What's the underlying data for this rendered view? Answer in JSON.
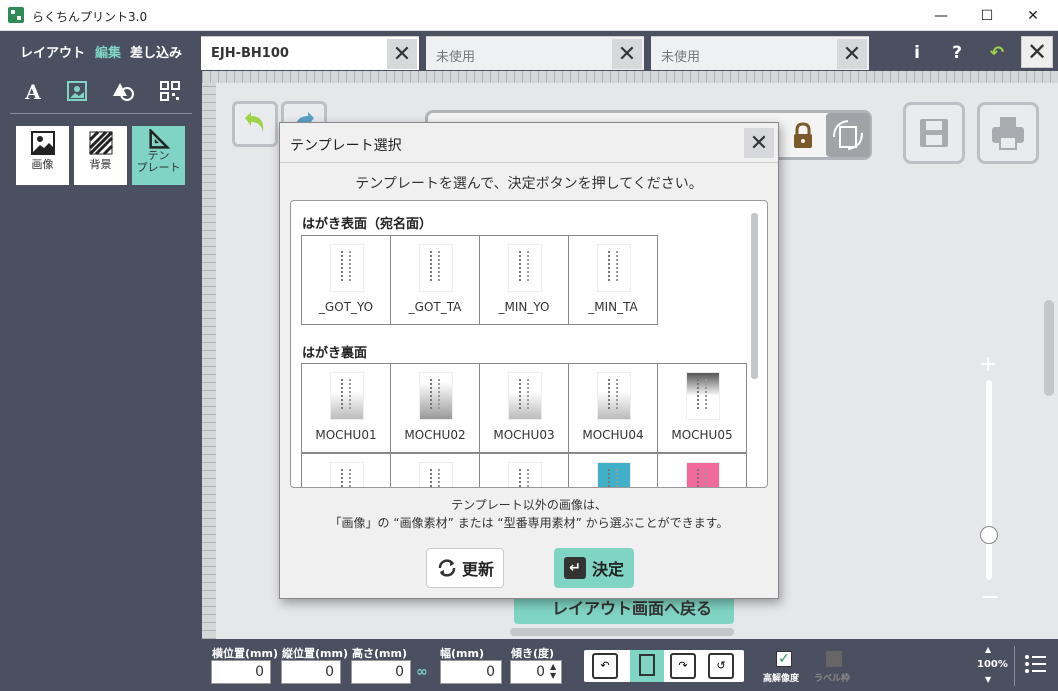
{
  "app": {
    "title": "らくちんプリント3.0"
  },
  "menu": {
    "layout": "レイアウト",
    "edit": "編集",
    "merge": "差し込み"
  },
  "tabs": [
    {
      "label": "EJH-BH100"
    },
    {
      "label": "未使用"
    },
    {
      "label": "未使用"
    }
  ],
  "header_icons": {
    "info": "i",
    "help": "?"
  },
  "tools": {
    "image_label": "画像",
    "background_label": "背景",
    "template_label": "テン\nプレート"
  },
  "canvas": {
    "back_to_layout": "レイアウト画面へ戻る"
  },
  "bottom": {
    "x_label": "横位置(mm)",
    "x_value": "0",
    "y_label": "縦位置(mm)",
    "y_value": "0",
    "h_label": "高さ(mm)",
    "h_value": "0",
    "w_label": "幅(mm)",
    "w_value": "0",
    "angle_label": "傾き(度)",
    "angle_value": "0",
    "hires_label": "高解像度",
    "label_frame_label": "ラベル枠",
    "zoom": "100%"
  },
  "dialog": {
    "title": "テンプレート選択",
    "instruction": "テンプレートを選んで、決定ボタンを押してください。",
    "section1": {
      "heading": "はがき表面（宛名面）",
      "items": [
        "_GOT_YO",
        "_GOT_TA",
        "_MIN_YO",
        "_MIN_TA"
      ]
    },
    "section2": {
      "heading": "はがき裏面",
      "items": [
        "MOCHU01",
        "MOCHU02",
        "MOCHU03",
        "MOCHU04",
        "MOCHU05"
      ]
    },
    "note1": "テンプレート以外の画像は、",
    "note2": "「画像」の “画像素材” または “型番専用素材” から選ぶことができます。",
    "refresh_label": "更新",
    "ok_label": "決定"
  },
  "colors": {
    "dark_panel": "#4a5060",
    "accent": "#7fd4c4"
  }
}
